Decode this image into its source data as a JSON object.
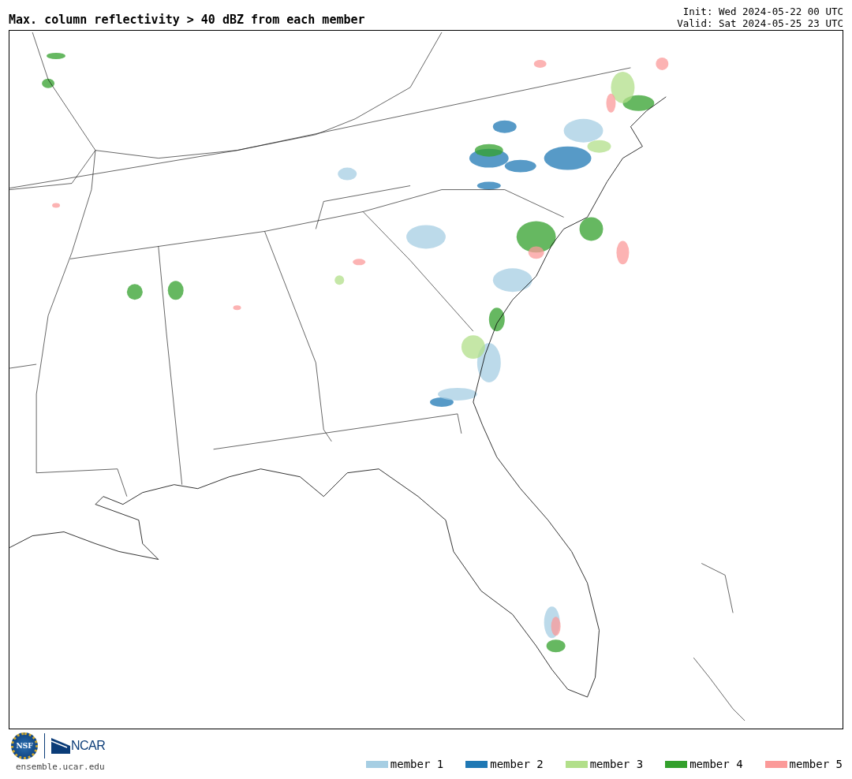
{
  "title": "Max. column reflectivity > 40 dBZ from each member",
  "init": "Init: Wed 2024-05-22 00 UTC",
  "valid": "Valid: Sat 2024-05-25 23 UTC",
  "logos": {
    "nsf": "NSF",
    "ncar": "NCAR"
  },
  "site": "ensemble.ucar.edu",
  "legend": [
    {
      "label": "member 1",
      "color": "#a6cee3"
    },
    {
      "label": "member 2",
      "color": "#1f78b4"
    },
    {
      "label": "member 3",
      "color": "#b2df8a"
    },
    {
      "label": "member 4",
      "color": "#33a02c"
    },
    {
      "label": "member 5",
      "color": "#fb9a99"
    }
  ]
}
